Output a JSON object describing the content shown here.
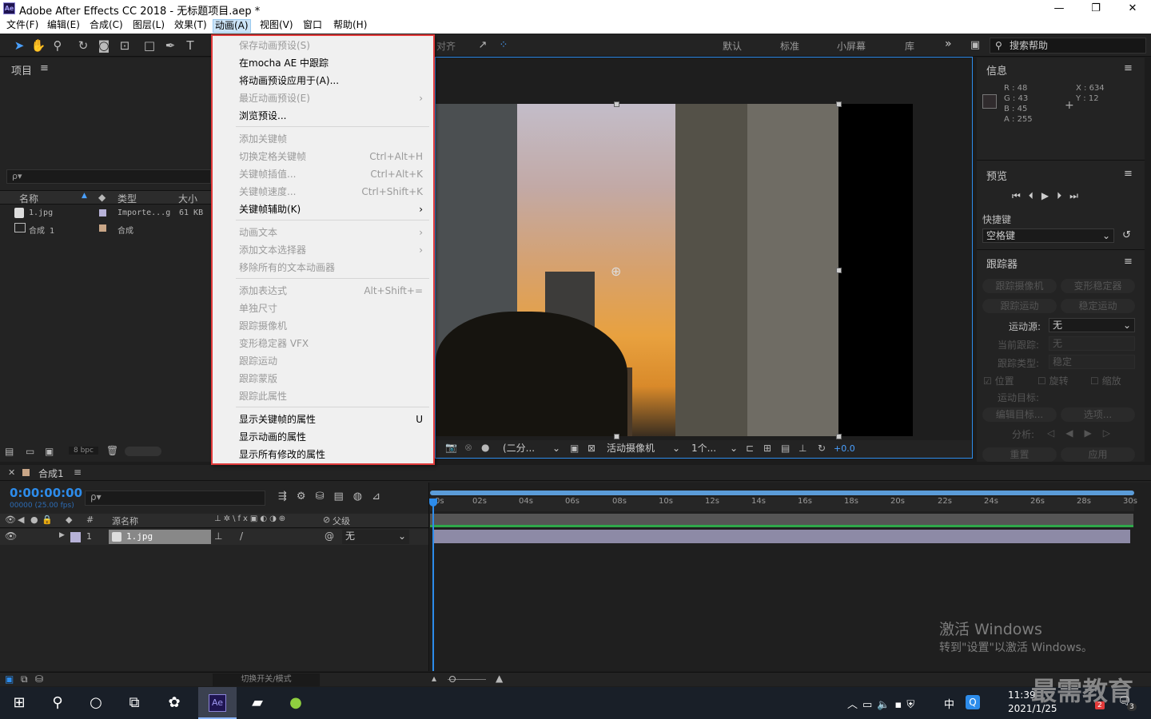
{
  "window": {
    "title": "Adobe After Effects CC 2018 - 无标题项目.aep *",
    "logo": "Ae",
    "minimize": "—",
    "restore": "❐",
    "close": "✕"
  },
  "menubar": [
    {
      "label": "文件(F)"
    },
    {
      "label": "编辑(E)"
    },
    {
      "label": "合成(C)"
    },
    {
      "label": "图层(L)"
    },
    {
      "label": "效果(T)"
    },
    {
      "label": "动画(A)"
    },
    {
      "label": "视图(V)"
    },
    {
      "label": "窗口"
    },
    {
      "label": "帮助(H)"
    }
  ],
  "toolbar": {
    "align_label": "对齐",
    "workspaces": [
      "默认",
      "标准",
      "小屏幕",
      "库"
    ],
    "more": "»",
    "search_help": "搜索帮助"
  },
  "animation_menu": {
    "items": [
      {
        "label": "保存动画预设(S)",
        "shortcut": "",
        "disabled": true
      },
      {
        "label": "在mocha AE 中跟踪",
        "shortcut": "",
        "disabled": false
      },
      {
        "label": "将动画预设应用于(A)...",
        "shortcut": "",
        "disabled": false
      },
      {
        "label": "最近动画预设(E)",
        "shortcut": "›",
        "disabled": true
      },
      {
        "label": "浏览预设...",
        "shortcut": "",
        "disabled": false
      },
      {
        "label": "添加关键帧",
        "shortcut": "",
        "disabled": true
      },
      {
        "label": "切换定格关键帧",
        "shortcut": "Ctrl+Alt+H",
        "disabled": true
      },
      {
        "label": "关键帧插值...",
        "shortcut": "Ctrl+Alt+K",
        "disabled": true
      },
      {
        "label": "关键帧速度...",
        "shortcut": "Ctrl+Shift+K",
        "disabled": true
      },
      {
        "label": "关键帧辅助(K)",
        "shortcut": "›",
        "disabled": false
      },
      {
        "label": "动画文本",
        "shortcut": "›",
        "disabled": true
      },
      {
        "label": "添加文本选择器",
        "shortcut": "›",
        "disabled": true
      },
      {
        "label": "移除所有的文本动画器",
        "shortcut": "",
        "disabled": true
      },
      {
        "label": "添加表达式",
        "shortcut": "Alt+Shift+=",
        "disabled": true
      },
      {
        "label": "单独尺寸",
        "shortcut": "",
        "disabled": true
      },
      {
        "label": "跟踪摄像机",
        "shortcut": "",
        "disabled": true
      },
      {
        "label": "变形稳定器 VFX",
        "shortcut": "",
        "disabled": true
      },
      {
        "label": "跟踪运动",
        "shortcut": "",
        "disabled": true
      },
      {
        "label": "跟踪蒙版",
        "shortcut": "",
        "disabled": true
      },
      {
        "label": "跟踪此属性",
        "shortcut": "",
        "disabled": true
      },
      {
        "label": "显示关键帧的属性",
        "shortcut": "U",
        "disabled": false
      },
      {
        "label": "显示动画的属性",
        "shortcut": "",
        "disabled": false
      },
      {
        "label": "显示所有修改的属性",
        "shortcut": "",
        "disabled": false
      }
    ]
  },
  "project": {
    "title": "项目",
    "menu": "≡",
    "search_placeholder": "ρ▾",
    "columns": [
      "名称",
      "类型",
      "大小"
    ],
    "rows": [
      {
        "name": "1.jpg",
        "type": "Importe...g",
        "size": "61 KB",
        "swatch": "#b7b2d8"
      },
      {
        "name": "合成 1",
        "type": "合成",
        "size": "",
        "swatch": "#c9a687"
      }
    ],
    "bpc": "8 bpc"
  },
  "viewer_bar": {
    "resolution": "(二分...",
    "camera": "活动摄像机",
    "views": "1个...",
    "exposure": "+0.0"
  },
  "info_panel": {
    "title": "信息",
    "r": "R : 48",
    "g": "G : 43",
    "b": "B : 45",
    "a": "A : 255",
    "x": "X : 634",
    "y": "Y : 12"
  },
  "preview_panel": {
    "title": "预览",
    "shortcut_label": "快捷键",
    "shortcut_value": "空格键"
  },
  "tracker_panel": {
    "title": "跟踪器",
    "track_camera": "跟踪摄像机",
    "warp_stabilizer": "变形稳定器",
    "track_motion": "跟踪运动",
    "stabilize_motion": "稳定运动",
    "motion_source_label": "运动源:",
    "motion_source_value": "无",
    "current_track_label": "当前跟踪:",
    "current_track_value": "无",
    "track_type_label": "跟踪类型:",
    "track_type_value": "稳定",
    "position": "位置",
    "rotation": "旋转",
    "scale": "缩放",
    "motion_target": "运动目标:",
    "edit_target": "编辑目标...",
    "options": "选项...",
    "analyze": "分析:",
    "reset": "重置",
    "apply": "应用"
  },
  "timeline": {
    "comp_name": "合成1",
    "timecode": "0:00:00:00",
    "fps": "00000 (25.00 fps)",
    "col_source": "源名称",
    "col_parent": "父级",
    "layer_num": "1",
    "layer_name": "1.jpg",
    "parent_value": "无",
    "toggle_modes": "切换开关/模式",
    "ticks": [
      "0s",
      "02s",
      "04s",
      "06s",
      "08s",
      "10s",
      "12s",
      "14s",
      "16s",
      "18s",
      "20s",
      "22s",
      "24s",
      "26s",
      "28s",
      "30s"
    ]
  },
  "watermark": {
    "line1": "激活 Windows",
    "line2": "转到\"设置\"以激活 Windows。",
    "brand": "最需教育"
  },
  "taskbar": {
    "time": "11:39",
    "date": "2021/1/25",
    "ime": "中",
    "notif_count": "3",
    "app_badge": "2"
  },
  "colors": {
    "accent_blue": "#2d8ceb",
    "menu_highlight_border": "#e23b3b",
    "timecode_blue": "#2d8ceb",
    "layer_bar": "#8d8aa6"
  }
}
